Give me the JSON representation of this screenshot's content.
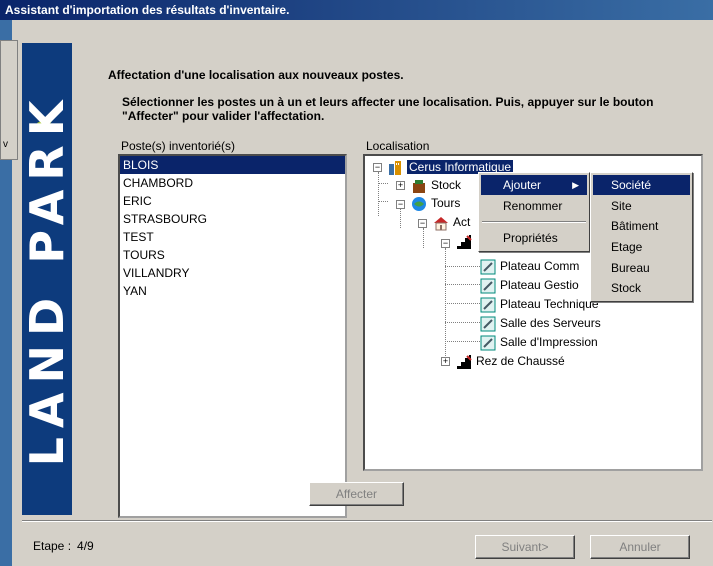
{
  "window": {
    "title": "Assistant d'importation des résultats d'inventaire."
  },
  "background_window": {
    "text": "v"
  },
  "brand": {
    "name": "LAND PARK",
    "color": "#0d3b7d",
    "accent": "#a8c838"
  },
  "header": {
    "title": "Affectation d'une localisation aux nouveaux postes.",
    "description": "Sélectionner les postes un à un et leurs affecter une localisation. Puis, appuyer sur le bouton \"Affecter\" pour valider l'affectation."
  },
  "postes": {
    "label": "Poste(s) inventorié(s)",
    "items": [
      "BLOIS",
      "CHAMBORD",
      "ERIC",
      "STRASBOURG",
      "TEST",
      "TOURS",
      "VILLANDRY",
      "YAN"
    ],
    "selected": "BLOIS"
  },
  "localisation": {
    "label": "Localisation",
    "tree": {
      "root": "Cerus Informatique",
      "stock": "Stock",
      "tours": "Tours",
      "act": "Act",
      "plateau_comm": "Plateau Comm",
      "plateau_gestio": "Plateau Gestio",
      "plateau_technique": "Plateau Technique",
      "salle_serveurs": "Salle des Serveurs",
      "salle_impression": "Salle d'Impression",
      "rez": "Rez de Chaussé"
    }
  },
  "context_menu": {
    "ajouter": "Ajouter",
    "renommer": "Renommer",
    "proprietes": "Propriétés"
  },
  "submenu": {
    "items": [
      "Société",
      "Site",
      "Bâtiment",
      "Etage",
      "Bureau",
      "Stock"
    ],
    "highlighted": "Société"
  },
  "buttons": {
    "affecter": "Affecter",
    "suivant": "Suivant>",
    "annuler": "Annuler"
  },
  "footer": {
    "etape_label": "Etape :",
    "etape_value": "4/9"
  },
  "colors": {
    "selection": "#0a246a",
    "titlebar": "#0a246a",
    "face": "#d4d0c8"
  }
}
